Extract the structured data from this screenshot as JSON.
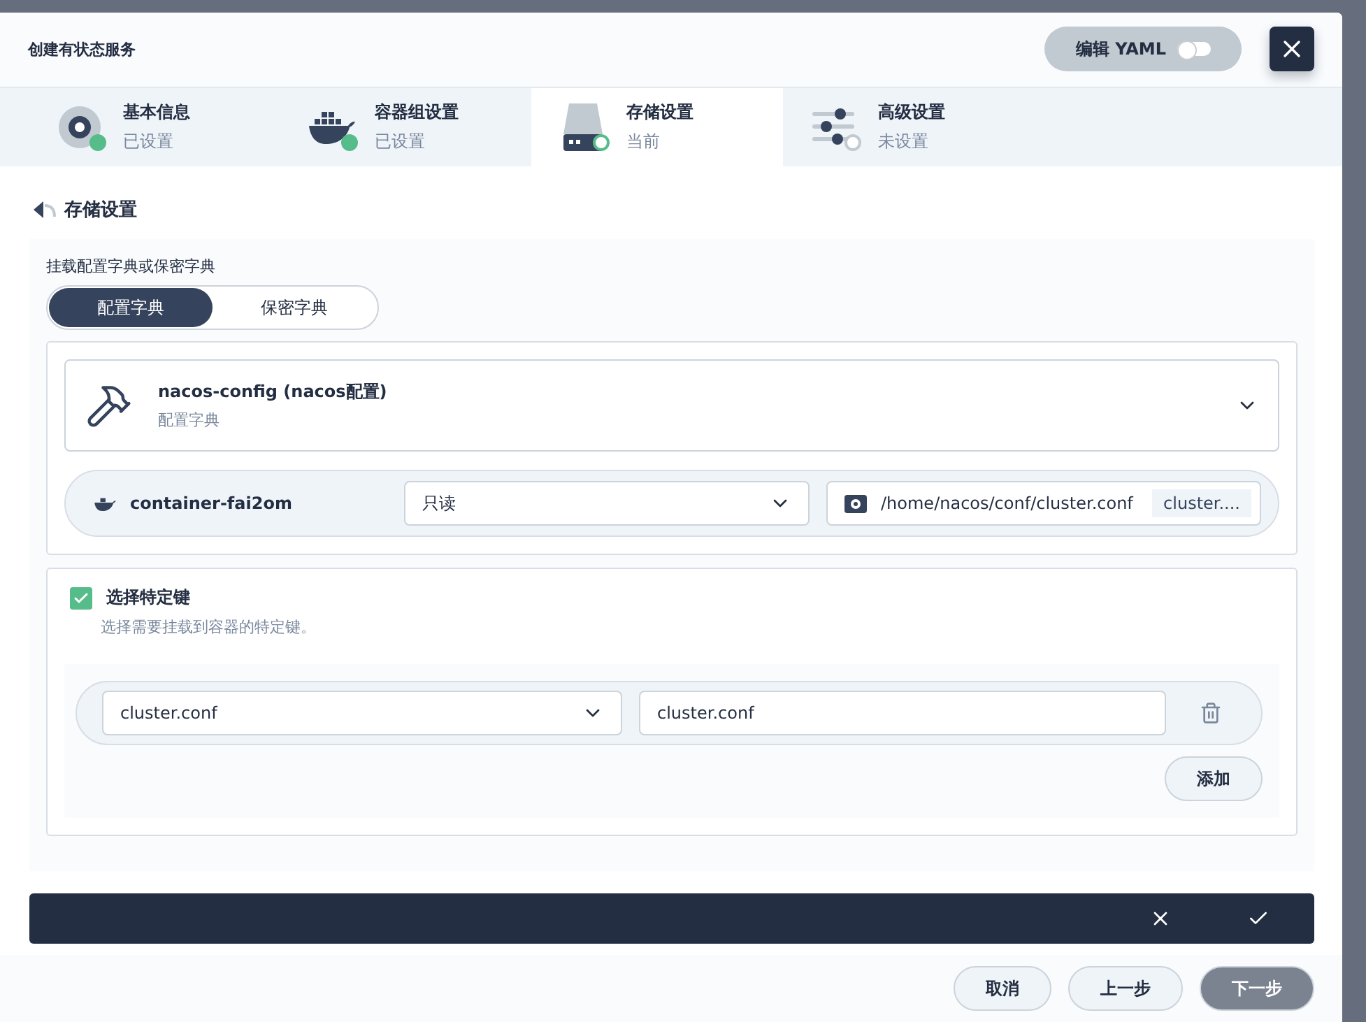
{
  "dialog": {
    "title": "创建有状态服务",
    "yaml_toggle": {
      "label": "编辑 YAML",
      "on": false
    }
  },
  "steps": [
    {
      "kind": "disc",
      "title": "基本信息",
      "status": "已设置",
      "completed": true,
      "selected": false
    },
    {
      "kind": "docker",
      "title": "容器组设置",
      "status": "已设置",
      "completed": true,
      "selected": false
    },
    {
      "kind": "drive",
      "title": "存储设置",
      "status": "当前",
      "completed": false,
      "selected": true
    },
    {
      "kind": "sliders",
      "title": "高级设置",
      "status": "未设置",
      "completed": false,
      "selected": false
    }
  ],
  "section_title": "存储设置",
  "mount_source": {
    "label": "挂载配置字典或保密字典",
    "options": [
      {
        "label": "配置字典",
        "selected": true
      },
      {
        "label": "保密字典",
        "selected": false
      }
    ]
  },
  "config": {
    "name": "nacos-config (nacos配置)",
    "type": "配置字典"
  },
  "mount": {
    "container": "container-fai2om",
    "mode": "只读",
    "path": "/home/nacos/conf/cluster.conf",
    "subpath": "cluster...."
  },
  "keys": {
    "checked": true,
    "label": "选择特定键",
    "description": "选择需要挂载到容器的特定键。",
    "rows": [
      {
        "key": "cluster.conf",
        "path": "cluster.conf"
      }
    ],
    "add": "添加"
  },
  "footer": {
    "buttons": [
      {
        "label": "取消",
        "kind": "plain"
      },
      {
        "label": "上一步",
        "kind": "plain"
      },
      {
        "label": "下一步",
        "kind": "primary"
      }
    ]
  }
}
